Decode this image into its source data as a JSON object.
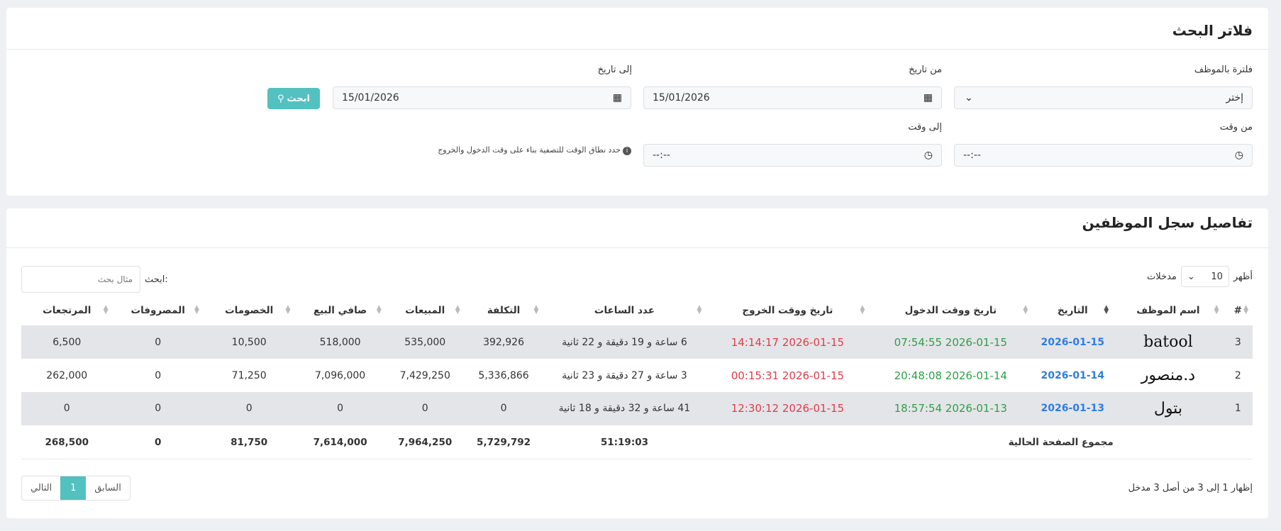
{
  "filters": {
    "title": "فلاتر البحث",
    "employee_label": "فلترة بالموظف",
    "employee_value": "إختر",
    "from_date_label": "من تاريخ",
    "from_date_value": "15/01/2026",
    "to_date_label": "إلى تاريخ",
    "to_date_value": "15/01/2026",
    "from_time_label": "من وقت",
    "from_time_value": "--:--",
    "to_time_label": "إلى وقت",
    "to_time_value": "--:--",
    "search_button": "ابحث",
    "time_hint": "حدد نطاق الوقت للتصفية بناء على وقت الدخول والخروج"
  },
  "log": {
    "title": "تفاصيل سجل الموظفين",
    "show_label": "أظهر",
    "page_size": "10",
    "entries_label": "مدخلات",
    "search_label": "ابحث:",
    "search_placeholder": "مثال بحث",
    "columns": [
      "#",
      "اسم الموظف",
      "التاريخ",
      "تاريخ ووقت الدخول",
      "تاريخ ووقت الخروج",
      "عدد الساعات",
      "التكلفة",
      "المبيعات",
      "صافي البيع",
      "الخصومات",
      "المصروفات",
      "المرتجعات"
    ],
    "rows": [
      {
        "num": "3",
        "employee": "batool",
        "date": "2026-01-15",
        "check_in": "2026-01-15 07:54:55",
        "check_out": "2026-01-15 14:14:17",
        "hours": "6 ساعة و 19 دقيقة و 22 ثانية",
        "cost": "392,926",
        "sales": "535,000",
        "net_sales": "518,000",
        "discounts": "10,500",
        "expenses": "0",
        "returns": "6,500"
      },
      {
        "num": "2",
        "employee": "د.منصور",
        "date": "2026-01-14",
        "check_in": "2026-01-14 20:48:08",
        "check_out": "2026-01-15 00:15:31",
        "hours": "3 ساعة و 27 دقيقة و 23 ثانية",
        "cost": "5,336,866",
        "sales": "7,429,250",
        "net_sales": "7,096,000",
        "discounts": "71,250",
        "expenses": "0",
        "returns": "262,000"
      },
      {
        "num": "1",
        "employee": "بتول",
        "date": "2026-01-13",
        "check_in": "2026-01-13 18:57:54",
        "check_out": "2026-01-15 12:30:12",
        "hours": "41 ساعة و 32 دقيقة و 18 ثانية",
        "cost": "0",
        "sales": "0",
        "net_sales": "0",
        "discounts": "0",
        "expenses": "0",
        "returns": "0"
      }
    ],
    "footer": {
      "label": "مجموع الصفحة الحالية",
      "hours": "51:19:03",
      "cost": "5,729,792",
      "sales": "7,964,250",
      "net_sales": "7,614,000",
      "discounts": "81,750",
      "expenses": "0",
      "returns": "268,500"
    },
    "info": "إظهار 1 إلى 3 من أصل 3 مدخل",
    "pager": {
      "prev": "السابق",
      "current": "1",
      "next": "التالي"
    }
  }
}
